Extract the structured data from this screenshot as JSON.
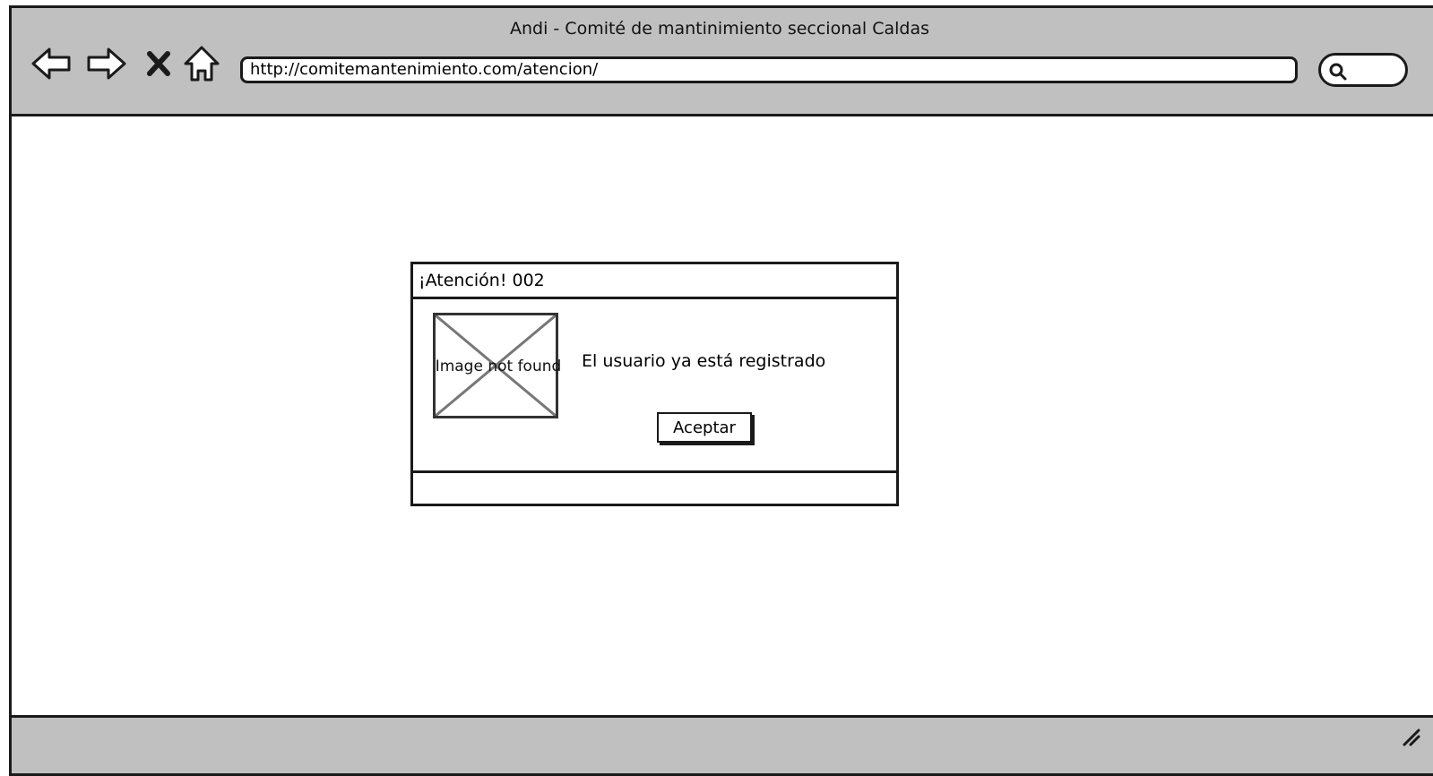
{
  "window": {
    "title": "Andi - Comité de mantinimiento seccional Caldas",
    "url": "http://comitemantenimiento.com/atencion/"
  },
  "nav": {
    "back_icon": "back-arrow-icon",
    "forward_icon": "forward-arrow-icon",
    "stop_icon": "close-icon",
    "home_icon": "home-icon",
    "search_icon": "search-icon"
  },
  "dialog": {
    "title": "¡Atención! 002",
    "image_placeholder": "Image not found",
    "message": "El usuario ya está registrado",
    "accept_label": "Aceptar"
  },
  "colors": {
    "chrome": "#c0c0c0",
    "stroke": "#1a1a1a",
    "background": "#ffffff"
  }
}
